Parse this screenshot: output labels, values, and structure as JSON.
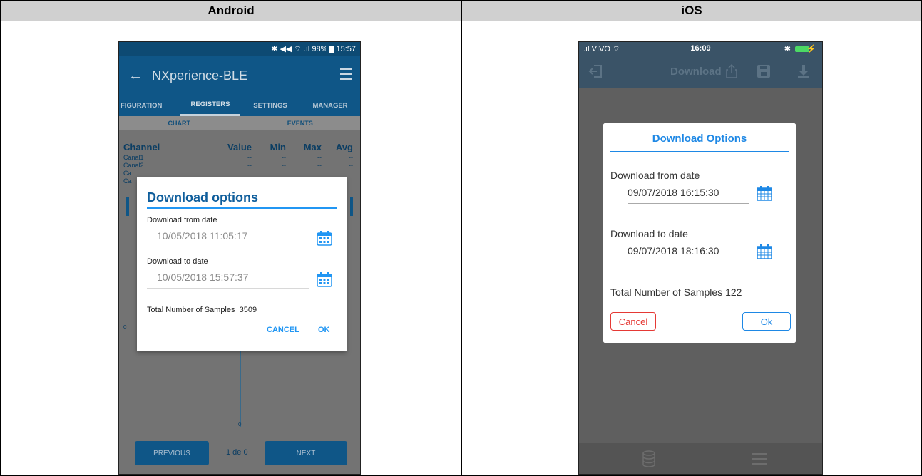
{
  "table": {
    "android_header": "Android",
    "ios_header": "iOS"
  },
  "android": {
    "status": {
      "icons": "✱ ◀◀ ⌔ .ıl",
      "battery": "98%",
      "time": "15:57"
    },
    "app_title": "NXperience-BLE",
    "tabs": [
      "FIGURATION",
      "REGISTERS",
      "SETTINGS",
      "MANAGER"
    ],
    "active_tab": "REGISTERS",
    "subtabs": [
      "CHART",
      "EVENTS"
    ],
    "table_headers": [
      "Channel",
      "Value",
      "Min",
      "Max",
      "Avg"
    ],
    "channels": [
      {
        "name": "Canal1",
        "value": "--",
        "min": "--",
        "max": "--",
        "avg": "--"
      },
      {
        "name": "Canal2",
        "value": "--",
        "min": "--",
        "max": "--",
        "avg": "--"
      },
      {
        "name": "Ca",
        "value": "",
        "min": "",
        "max": "",
        "avg": ""
      },
      {
        "name": "Ca",
        "value": "",
        "min": "",
        "max": "",
        "avg": ""
      }
    ],
    "chart_zero_left": "0",
    "chart_zero_bottom": "0",
    "previous_label": "PREVIOUS",
    "page_indicator": "1 de 0",
    "next_label": "NEXT",
    "dialog": {
      "title": "Download options",
      "from_label": "Download from date",
      "from_value": "10/05/2018 11:05:17",
      "to_label": "Download to date",
      "to_value": "10/05/2018 15:57:37",
      "total_label": "Total Number of Samples",
      "total_value": "3509",
      "cancel_label": "CANCEL",
      "ok_label": "OK"
    },
    "colors": {
      "accent": "#2196f3",
      "toolbar": "#0f5687"
    }
  },
  "ios": {
    "status": {
      "carrier": ".ıl VIVO ⌔",
      "time": "16:09",
      "bluetooth": "✱",
      "charging": "⚡"
    },
    "toolbar_title": "Download",
    "icons": [
      "exit-icon",
      "share-icon",
      "save-icon",
      "download-icon",
      "database-icon",
      "menu-icon"
    ],
    "dialog": {
      "title": "Download Options",
      "from_label": "Download from date",
      "from_value": "09/07/2018 16:15:30",
      "to_label": "Download to date",
      "to_value": "09/07/2018 18:16:30",
      "total_text": "Total Number of Samples 122",
      "cancel_label": "Cancel",
      "ok_label": "Ok"
    },
    "colors": {
      "accent": "#1e88e5",
      "cancel": "#e53935"
    }
  }
}
